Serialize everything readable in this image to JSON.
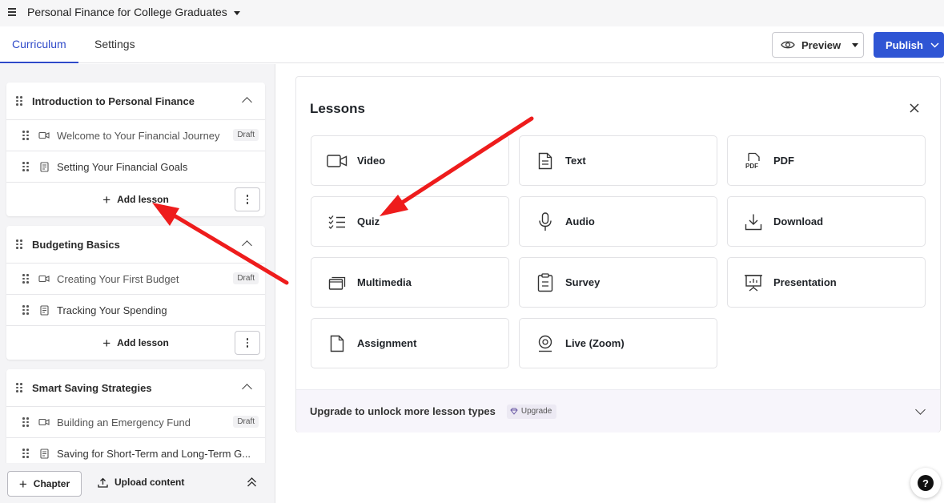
{
  "header": {
    "course_title": "Personal Finance for College Graduates"
  },
  "tabs": [
    {
      "label": "Curriculum",
      "active": true
    },
    {
      "label": "Settings",
      "active": false
    }
  ],
  "actions": {
    "preview_label": "Preview",
    "publish_label": "Publish"
  },
  "chapters": [
    {
      "title": "Introduction to Personal Finance",
      "lessons": [
        {
          "title": "Welcome to Your Financial Journey",
          "type": "video",
          "badge": "Draft"
        },
        {
          "title": "Setting Your Financial Goals",
          "type": "text",
          "badge": ""
        }
      ],
      "add_label": "Add lesson"
    },
    {
      "title": "Budgeting Basics",
      "lessons": [
        {
          "title": "Creating Your First Budget",
          "type": "video",
          "badge": "Draft"
        },
        {
          "title": "Tracking Your Spending",
          "type": "text",
          "badge": ""
        }
      ],
      "add_label": "Add lesson"
    },
    {
      "title": "Smart Saving Strategies",
      "lessons": [
        {
          "title": "Building an Emergency Fund",
          "type": "video",
          "badge": "Draft"
        },
        {
          "title": "Saving for Short-Term and Long-Term G...",
          "type": "text",
          "badge": ""
        }
      ]
    }
  ],
  "sidebar_footer": {
    "chapter_label": "Chapter",
    "upload_label": "Upload content"
  },
  "lessons_panel": {
    "title": "Lessons",
    "types": [
      {
        "label": "Video",
        "icon": "video-camera-icon"
      },
      {
        "label": "Text",
        "icon": "document-text-icon"
      },
      {
        "label": "PDF",
        "icon": "pdf-file-icon"
      },
      {
        "label": "Quiz",
        "icon": "checklist-icon"
      },
      {
        "label": "Audio",
        "icon": "microphone-icon"
      },
      {
        "label": "Download",
        "icon": "download-icon"
      },
      {
        "label": "Multimedia",
        "icon": "multimedia-icon"
      },
      {
        "label": "Survey",
        "icon": "clipboard-icon"
      },
      {
        "label": "Presentation",
        "icon": "presentation-board-icon"
      },
      {
        "label": "Assignment",
        "icon": "file-icon"
      },
      {
        "label": "Live (Zoom)",
        "icon": "webcam-icon"
      }
    ],
    "upgrade_text": "Upgrade to unlock more lesson types",
    "upgrade_badge": "Upgrade"
  },
  "colors": {
    "accent": "#2f55d4",
    "tab_active": "#2f4ac9",
    "annotation_arrow": "#ee1c1c"
  }
}
